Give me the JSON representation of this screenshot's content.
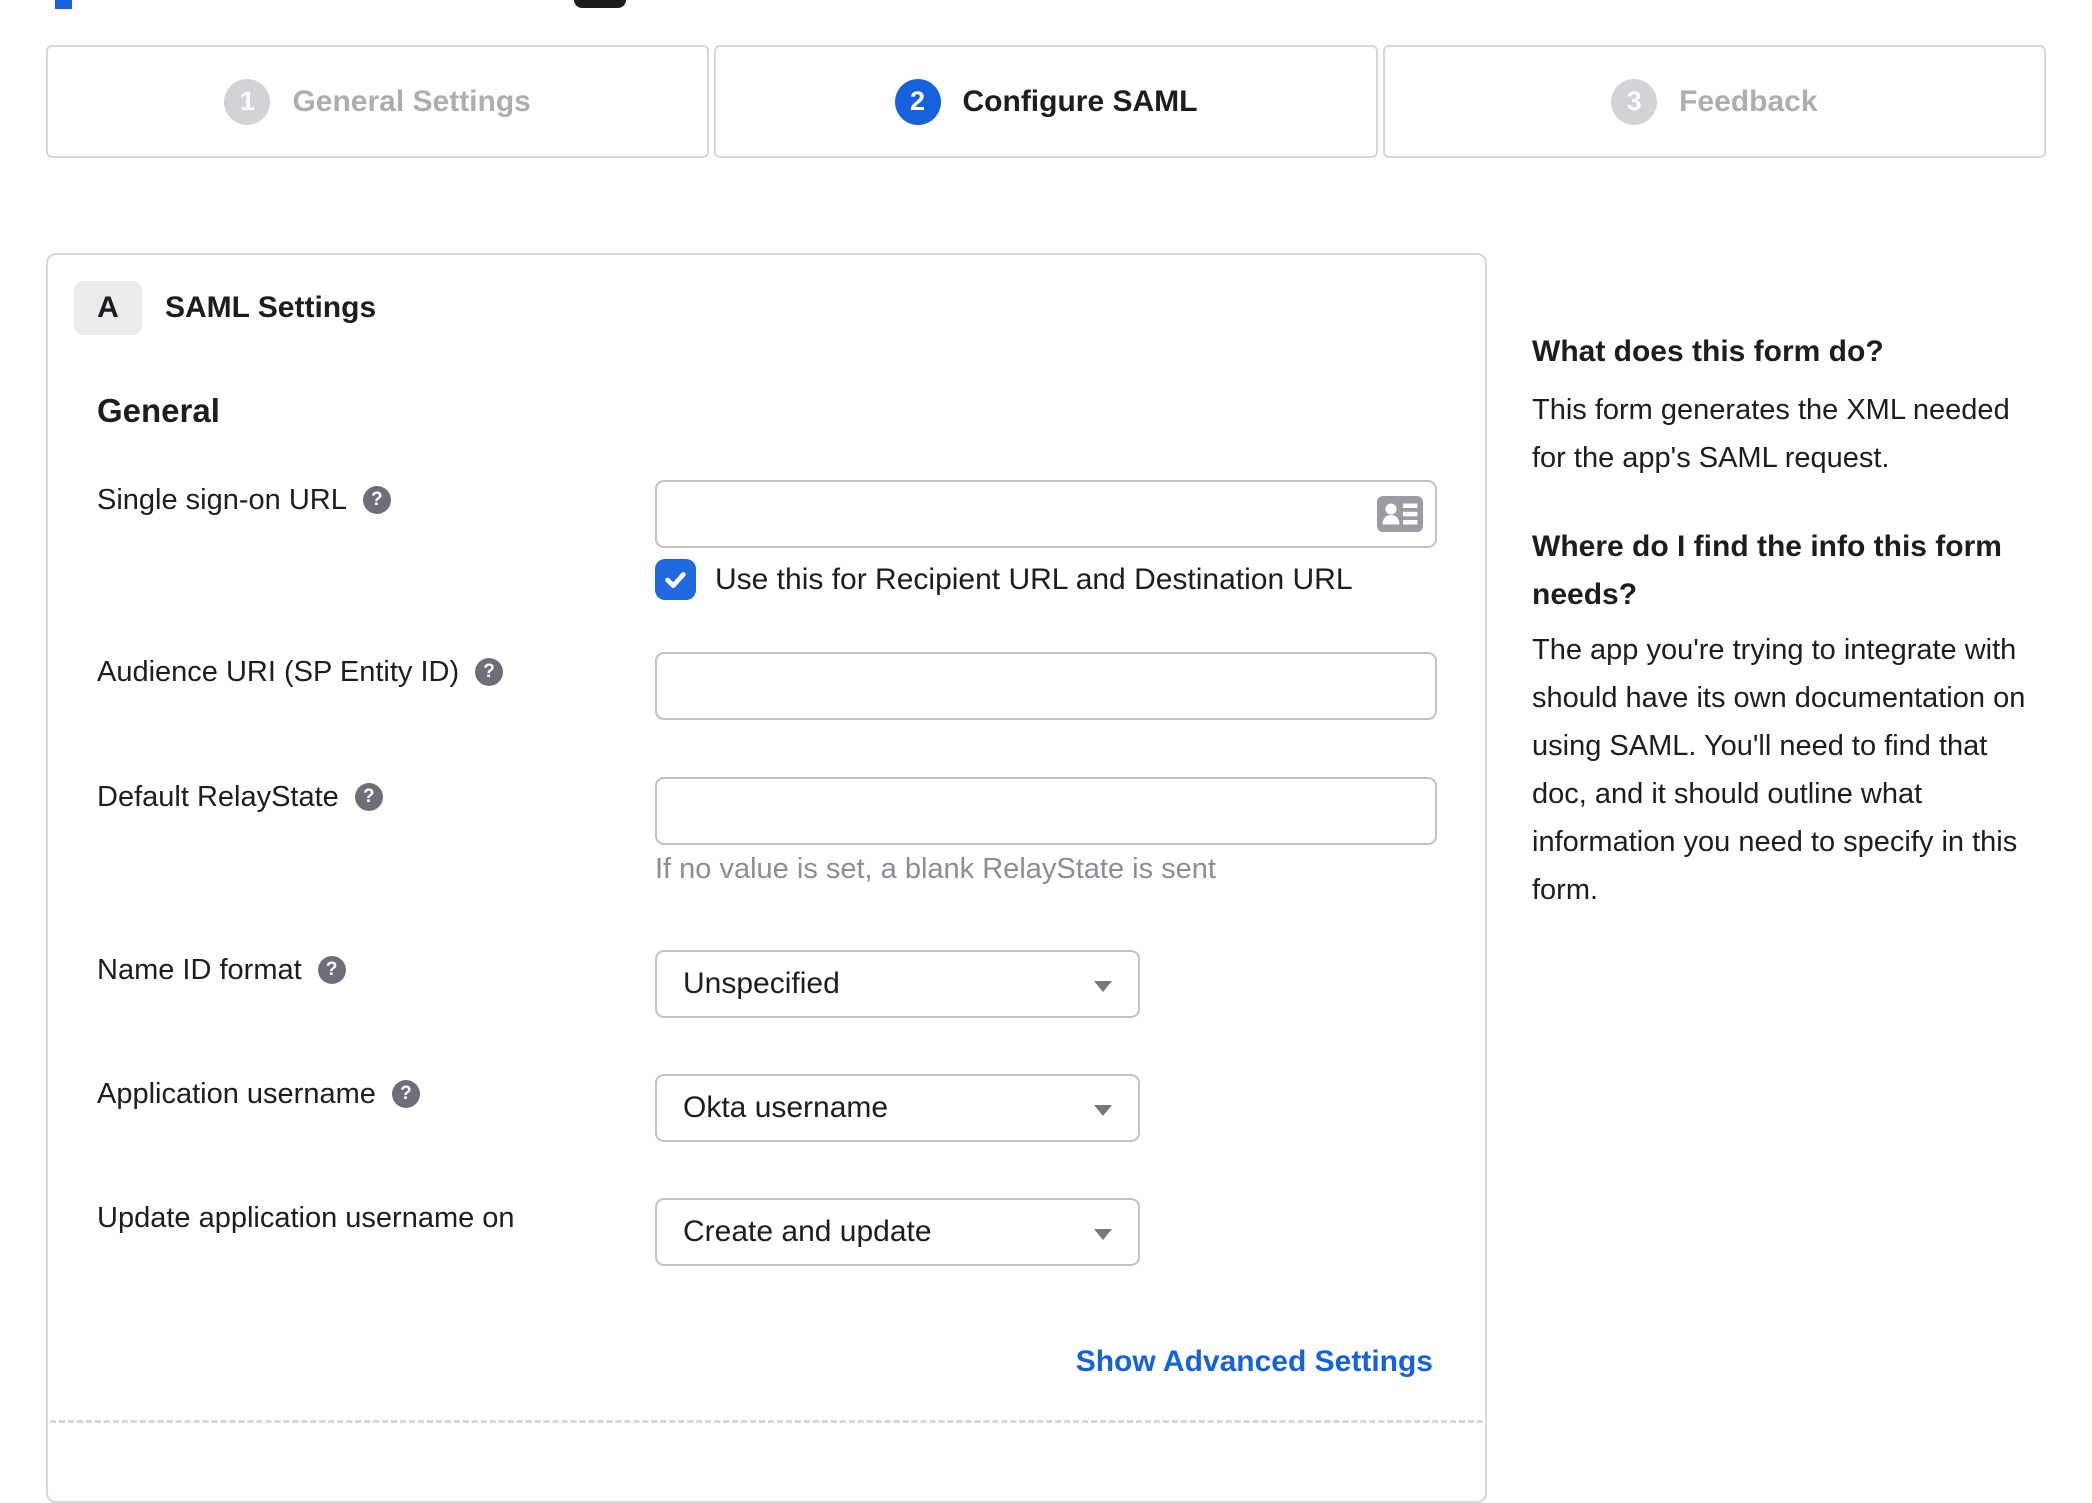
{
  "colors": {
    "accent": "#1662dd",
    "checkbox_blue": "#2069e1",
    "panel_border": "#d7d7dc",
    "input_border": "#c1c1c7",
    "text": "#1d1d21",
    "muted_text": "#8d8d95",
    "inactive_step": "#aeaeb2",
    "badge_bg": "#ebebed",
    "help_icon_bg": "#6e6e78",
    "card_icon_gray": "#9b9ba3"
  },
  "stepper": {
    "steps": [
      {
        "number": "1",
        "label": "General Settings",
        "state": "inactive"
      },
      {
        "number": "2",
        "label": "Configure SAML",
        "state": "active"
      },
      {
        "number": "3",
        "label": "Feedback",
        "state": "inactive"
      }
    ]
  },
  "panel": {
    "section_badge": "A",
    "section_title": "SAML Settings",
    "group_heading": "General",
    "fields": {
      "sso_url": {
        "label": "Single sign-on URL",
        "value": "",
        "has_help": true,
        "icon": "contact-card-icon"
      },
      "sso_checkbox": {
        "label": "Use this for Recipient URL and Destination URL",
        "checked": true
      },
      "audience_uri": {
        "label": "Audience URI (SP Entity ID)",
        "value": "",
        "has_help": true
      },
      "relay_state": {
        "label": "Default RelayState",
        "value": "",
        "has_help": true,
        "hint": "If no value is set, a blank RelayState is sent"
      },
      "name_id_format": {
        "label": "Name ID format",
        "value": "Unspecified",
        "has_help": true
      },
      "app_username": {
        "label": "Application username",
        "value": "Okta username",
        "has_help": true
      },
      "update_username_on": {
        "label": "Update application username on",
        "value": "Create and update",
        "has_help": false
      }
    },
    "advanced_link": "Show Advanced Settings"
  },
  "sidebar": {
    "q1": "What does this form do?",
    "a1": "This form generates the XML needed\nfor the app's SAML request.",
    "q2": "Where do I find the info this form\nneeds?",
    "a2": "The app you're trying to integrate with\nshould have its own documentation on\nusing SAML. You'll need to find that\ndoc, and it should outline what\ninformation you need to specify in this\nform."
  }
}
